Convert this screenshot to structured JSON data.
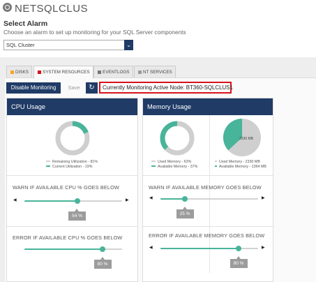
{
  "header": {
    "app_name": "NETSQLCLUS"
  },
  "alarm": {
    "title": "Select Alarm",
    "help": "Choose an alarm to set up monitoring for your SQL Server components",
    "selected": "SQL Cluster"
  },
  "tabs": [
    {
      "label": "DISKS",
      "active": false,
      "marker_color": "#f5a623"
    },
    {
      "label": "SYSTEM RESOURCES",
      "active": true,
      "marker_color": "#d7141a"
    },
    {
      "label": "EVENTLOGS",
      "active": false,
      "marker_color": "#777777"
    },
    {
      "label": "NT SERVICES",
      "active": false,
      "marker_color": "#9a9a9a"
    }
  ],
  "toolbar": {
    "disable_label": "Disable Monitoring",
    "save_label": "Save",
    "active_node_text": "Currently Monitoring Active Node: BT360-SQLCLUS1"
  },
  "cpu": {
    "title": "CPU Usage",
    "remaining_label": "Remaining Utilization -  81%",
    "current_label": "Current Utilization -  19%",
    "current_pct": 19,
    "warn": {
      "title": "WARN IF AVAILABLE CPU % GOES BELOW",
      "value": 54,
      "value_label": "54 %"
    },
    "error": {
      "title": "ERROR IF AVAILABLE CPU % GOES BELOW",
      "value": 80,
      "value_label": "80 %"
    }
  },
  "memory": {
    "title": "Memory Usage",
    "used_label": "Used Memory -  63%",
    "available_label": "Available Memory -  37%",
    "used_pct": 63,
    "pie_label": "2330 MB",
    "pie_used_mb_label": "Used Memory -  2330 MB",
    "pie_available_mb_label": "Available Memory -  1364 MB",
    "pie_used_mb": 2330,
    "pie_available_mb": 1364,
    "warn": {
      "title": "WARN IF AVAILABLE MEMORY GOES BELOW",
      "value": 25,
      "value_label": "25 %"
    },
    "error": {
      "title": "ERROR IF AVAILABLE MEMORY GOES BELOW",
      "value": 80,
      "value_label": "80 %"
    }
  },
  "colors": {
    "primary": "#1f3b66",
    "teal": "#48b49a",
    "gray": "#cfcfcf",
    "highlight_border": "#d7141a"
  },
  "icons": {
    "app": "database-icon",
    "dropdown": "chevron-down-icon",
    "refresh": "refresh-icon"
  }
}
